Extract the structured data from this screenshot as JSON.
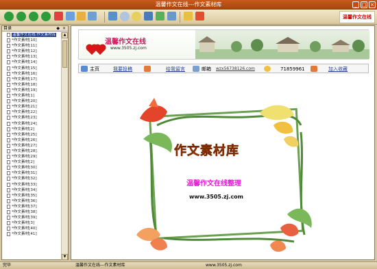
{
  "window": {
    "title": "温馨作文在线---作文素材库",
    "min": "_",
    "max": "□",
    "close": "×"
  },
  "brand": "温馨作文在线",
  "sidebar": {
    "title": "目录",
    "ctl_a": "◆",
    "ctl_b": "×",
    "items": [
      {
        "label": "温馨作文在线:作文素材库",
        "selected": true
      },
      {
        "label": "*作文素材[10]"
      },
      {
        "label": "*作文素材[11]"
      },
      {
        "label": "*作文素材[12]"
      },
      {
        "label": "*作文素材[13]"
      },
      {
        "label": "*作文素材[14]"
      },
      {
        "label": "*作文素材[15]"
      },
      {
        "label": "*作文素材[16]"
      },
      {
        "label": "*作文素材[17]"
      },
      {
        "label": "*作文素材[18]"
      },
      {
        "label": "*作文素材[19]"
      },
      {
        "label": "*作文素材[1]"
      },
      {
        "label": "*作文素材[20]"
      },
      {
        "label": "*作文素材[21]"
      },
      {
        "label": "*作文素材[22]"
      },
      {
        "label": "*作文素材[23]"
      },
      {
        "label": "*作文素材[24]"
      },
      {
        "label": "*作文素材[2]"
      },
      {
        "label": "*作文素材[25]"
      },
      {
        "label": "*作文素材[26]"
      },
      {
        "label": "*作文素材[27]"
      },
      {
        "label": "*作文素材[28]"
      },
      {
        "label": "*作文素材[29]"
      },
      {
        "label": "*作文素材[2]"
      },
      {
        "label": "*作文素材[30]"
      },
      {
        "label": "*作文素材[31]"
      },
      {
        "label": "*作文素材[32]"
      },
      {
        "label": "*作文素材[33]"
      },
      {
        "label": "*作文素材[34]"
      },
      {
        "label": "*作文素材[35]"
      },
      {
        "label": "*作文素材[36]"
      },
      {
        "label": "*作文素材[37]"
      },
      {
        "label": "*作文素材[38]"
      },
      {
        "label": "*作文素材[39]"
      },
      {
        "label": "*作文素材[3]"
      },
      {
        "label": "*作文素材[40]"
      },
      {
        "label": "*作文素材[41]"
      }
    ]
  },
  "banner": {
    "logo": "温馨作文在线",
    "url": "www.3505.zj.com"
  },
  "navbar": {
    "home": "主页",
    "submit": "我要投稿",
    "message": "给我留言",
    "mailbox_label": "邮箱",
    "email": "wzx56738126.com",
    "qq": "71859961",
    "favorite": "加入收藏"
  },
  "hero": {
    "title": "作文素材库",
    "subtitle": "温馨作文在线整理",
    "url": "www.3505.zj.com"
  },
  "status": {
    "left": "完毕",
    "center": "温馨作文在线---作文素材库",
    "right": "www.3505.zj.com"
  },
  "colors": {
    "titlebar": "#b24a14",
    "accent": "#d6145e",
    "link": "#223f9c"
  }
}
